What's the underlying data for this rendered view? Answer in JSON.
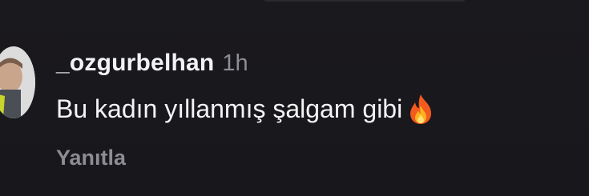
{
  "comment": {
    "username": "_ozgurbelhan",
    "timestamp": "1h",
    "text": "Bu kadın yıllanmış şalgam gibi",
    "emoji_icon": "fire-icon",
    "reply_label": "Yanıtla"
  },
  "colors": {
    "background": "#19181c",
    "primary_text": "#f4f4f6",
    "secondary_text": "#8e8d93"
  }
}
